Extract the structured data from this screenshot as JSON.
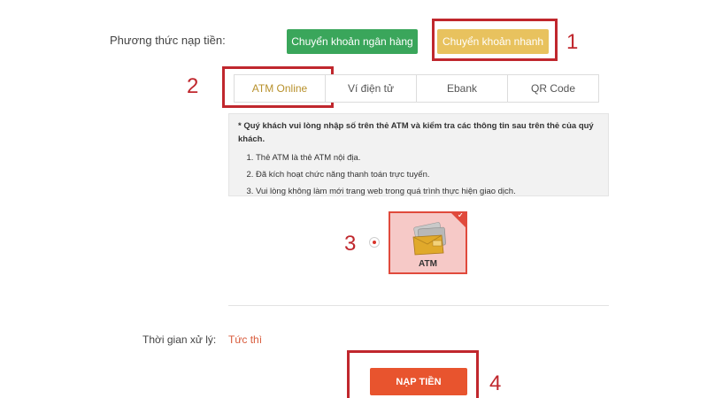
{
  "payment_method": {
    "label": "Phương thức nạp tiền:",
    "bank_transfer_label": "Chuyển khoản ngân hàng",
    "quick_transfer_label": "Chuyển khoản nhanh"
  },
  "tabs": [
    {
      "label": "ATM Online",
      "active": true
    },
    {
      "label": "Ví điện tử",
      "active": false
    },
    {
      "label": "Ebank",
      "active": false
    },
    {
      "label": "QR Code",
      "active": false
    }
  ],
  "info": {
    "intro": "* Quý khách vui lòng nhập số trên thẻ ATM và kiểm tra các thông tin sau trên thẻ của quý khách.",
    "items": [
      "Thẻ ATM là thẻ ATM nội địa.",
      "Đã kích hoạt chức năng thanh toán trực tuyến.",
      "Vui lòng không làm mới trang web trong quá trình thực hiện giao dịch."
    ]
  },
  "card_option": {
    "label": "ATM",
    "icon": "atm-card-icon",
    "selected": true
  },
  "processing_time": {
    "label": "Thời gian xử lý:",
    "value": "Tức thì"
  },
  "submit_label": "NẠP TIỀN",
  "annotations": {
    "step1": "1",
    "step2": "2",
    "step3": "3",
    "step4": "4"
  },
  "colors": {
    "bank_green": "#3aa65b",
    "quick_gold": "#e8c25e",
    "annotation_red": "#c0272d",
    "submit_orange": "#e8542e",
    "active_tab": "#b8912c"
  }
}
